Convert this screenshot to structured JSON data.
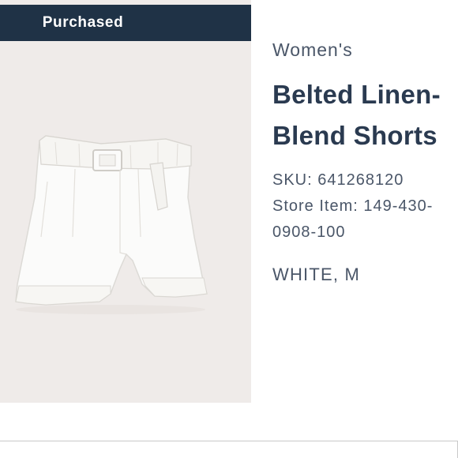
{
  "badge": {
    "label": "Purchased"
  },
  "product": {
    "category": "Women's",
    "title_line1": "Belted Linen-",
    "title_line2": "Blend Shorts",
    "sku": "SKU: 641268120",
    "store_item_line1": "Store Item: 149-430-",
    "store_item_line2": "0908-100",
    "variant": "WHITE, M"
  },
  "image": {
    "subject": "white-belted-linen-shorts"
  },
  "colors": {
    "badge_bg": "#1f3246",
    "image_bg": "#efebe9",
    "text": "#2a3a50"
  }
}
